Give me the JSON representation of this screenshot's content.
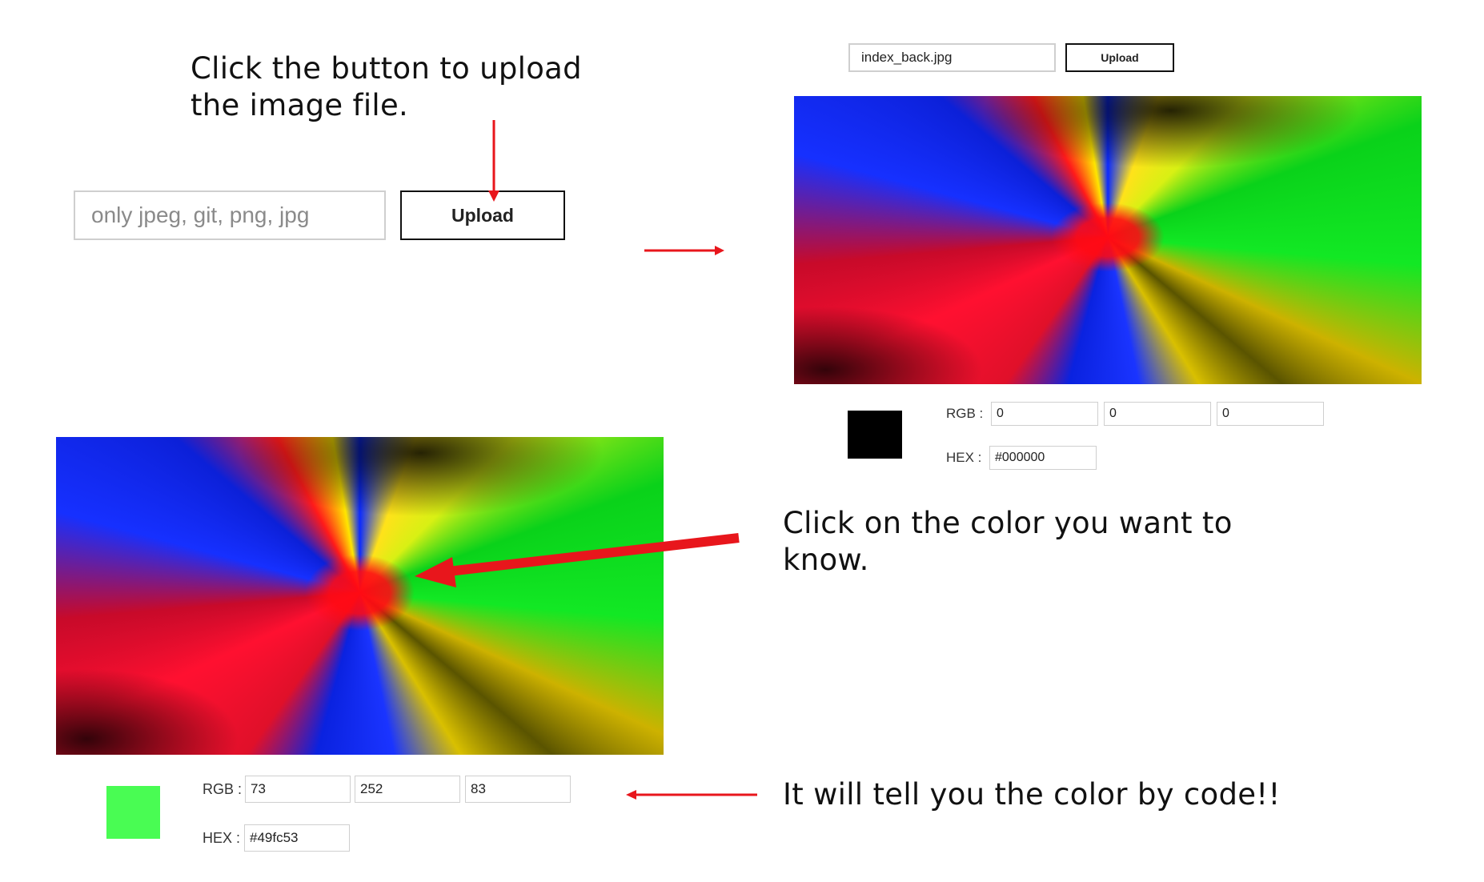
{
  "captions": {
    "step1_line1": "Click the button to upload",
    "step1_line2": "the image file.",
    "step2_line1": "Click on the color you want to",
    "step2_line2": "know.",
    "step3": "It will tell you the color by code!!"
  },
  "upload_initial": {
    "placeholder": "only jpeg, git, png, jpg",
    "button_label": "Upload"
  },
  "upload_loaded": {
    "filename": "index_back.jpg",
    "button_label": "Upload"
  },
  "result_black": {
    "rgb_label": "RGB :",
    "r": "0",
    "g": "0",
    "b": "0",
    "hex_label": "HEX :",
    "hex": "#000000",
    "swatch_color": "#000000"
  },
  "result_green": {
    "rgb_label": "RGB :",
    "r": "73",
    "g": "252",
    "b": "83",
    "hex_label": "HEX :",
    "hex": "#49fc53",
    "swatch_color": "#49fc53"
  },
  "colors": {
    "arrow": "#e8161c"
  },
  "images": {
    "preview": "color-splash-image",
    "picked": "color-splash-image"
  }
}
